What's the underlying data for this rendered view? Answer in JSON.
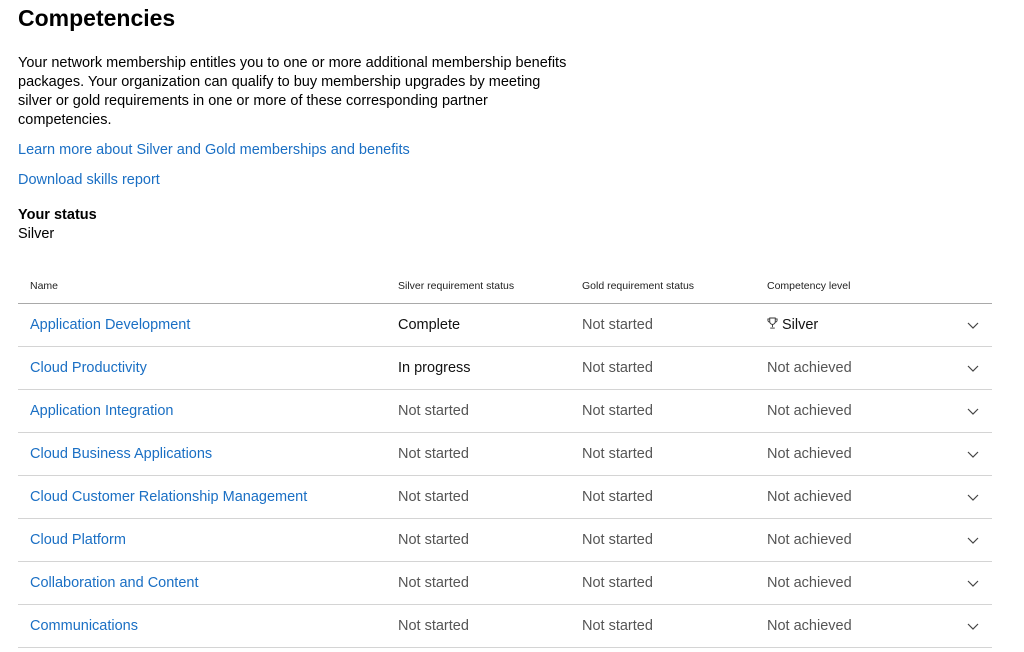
{
  "page": {
    "title": "Competencies",
    "intro": "Your network membership entitles you to one or more additional membership benefits packages. Your organization can qualify to buy membership upgrades by meeting silver or gold requirements in one or more of these corresponding partner competencies.",
    "links": {
      "learn_more": "Learn more about Silver and Gold memberships and benefits",
      "download": "Download skills report"
    },
    "status": {
      "label": "Your status",
      "value": "Silver"
    }
  },
  "table": {
    "headers": {
      "name": "Name",
      "silver": "Silver requirement status",
      "gold": "Gold requirement status",
      "level": "Competency level"
    },
    "rows": [
      {
        "name": "Application Development",
        "silver": "Complete",
        "gold": "Not started",
        "level": "Silver"
      },
      {
        "name": "Cloud Productivity",
        "silver": "In progress",
        "gold": "Not started",
        "level": "Not achieved"
      },
      {
        "name": "Application Integration",
        "silver": "Not started",
        "gold": "Not started",
        "level": "Not achieved"
      },
      {
        "name": "Cloud Business Applications",
        "silver": "Not started",
        "gold": "Not started",
        "level": "Not achieved"
      },
      {
        "name": "Cloud Customer Relationship Management",
        "silver": "Not started",
        "gold": "Not started",
        "level": "Not achieved"
      },
      {
        "name": "Cloud Platform",
        "silver": "Not started",
        "gold": "Not started",
        "level": "Not achieved"
      },
      {
        "name": "Collaboration and Content",
        "silver": "Not started",
        "gold": "Not started",
        "level": "Not achieved"
      },
      {
        "name": "Communications",
        "silver": "Not started",
        "gold": "Not started",
        "level": "Not achieved"
      }
    ]
  },
  "colors": {
    "link": "#1a6fc4",
    "muted_text": "#555555",
    "divider": "#d4d4d4"
  },
  "icons": {
    "trophy": "trophy-icon",
    "expand": "chevron-down-icon"
  }
}
